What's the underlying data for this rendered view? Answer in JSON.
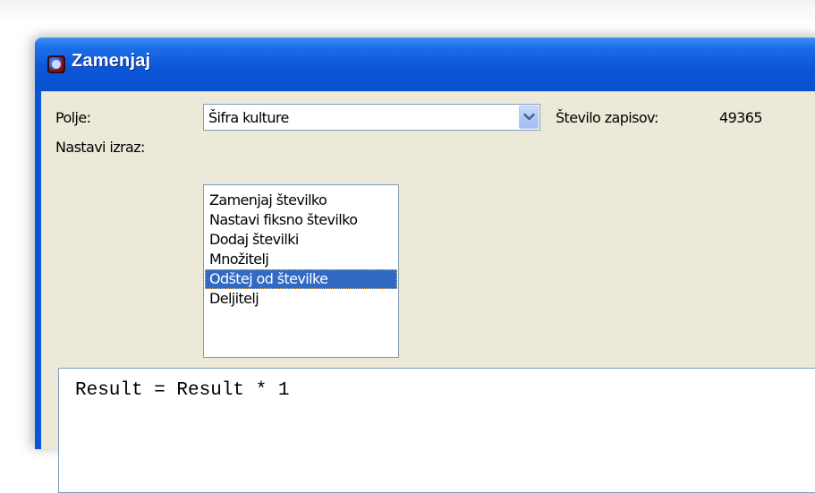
{
  "window": {
    "title": "Zamenjaj"
  },
  "form": {
    "field_label": "Polje:",
    "field_value": "Šifra kulture",
    "record_count_label": "Število zapisov:",
    "record_count_value": "49365",
    "expression_label": "Nastavi izraz:",
    "expression_options": [
      "Zamenjaj številko",
      "Nastavi fiksno številko",
      "Dodaj številki",
      "Množitelj",
      "Odštej od številke",
      "Deljitelj"
    ],
    "selected_option": "Odštej od številke",
    "expression_text": "Result = Result * 1"
  },
  "icons": {
    "title": "app-globe-icon",
    "dropdown": "chevron-down-icon"
  },
  "colors": {
    "titlebar": "#0b57d9",
    "client_bg": "#ece9d8",
    "selection": "#316ac5",
    "field_border": "#7f9db9"
  }
}
